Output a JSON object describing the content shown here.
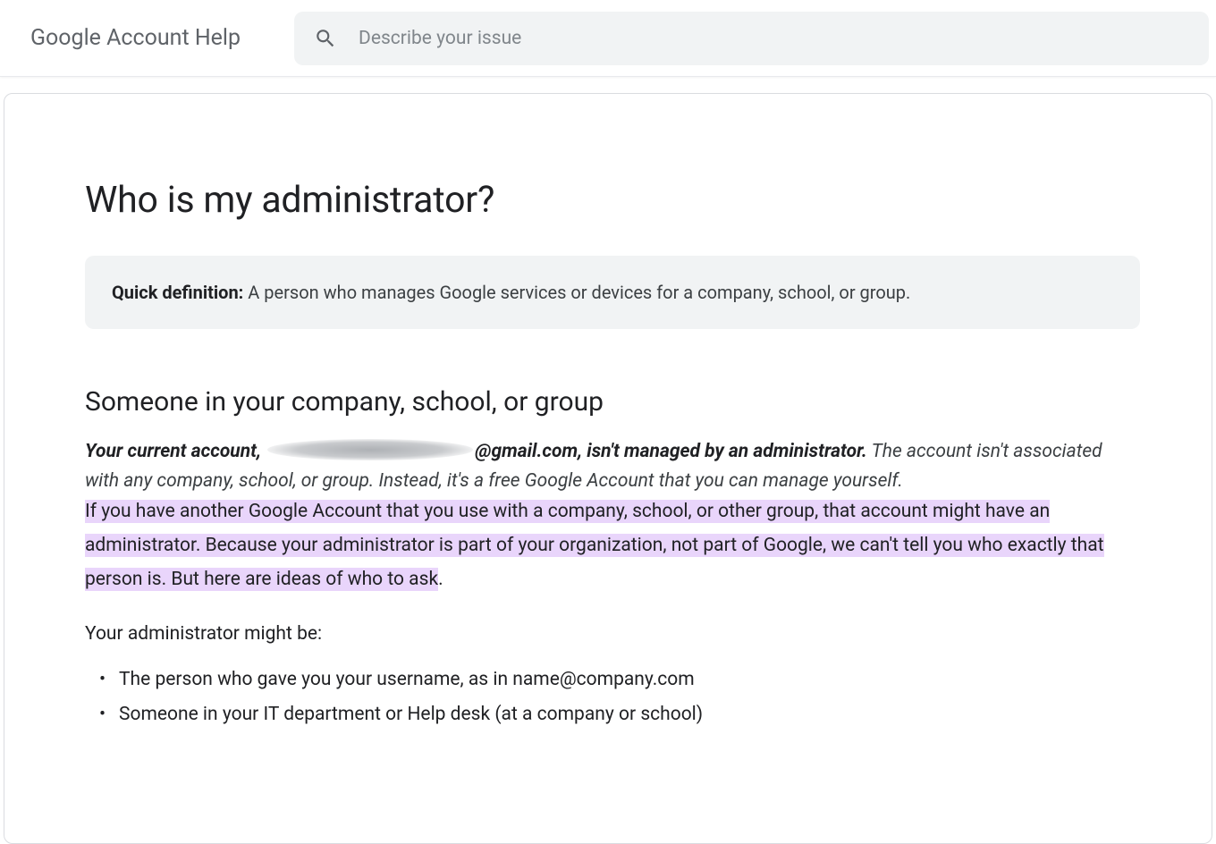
{
  "header": {
    "title": "Google Account Help",
    "search_placeholder": "Describe your issue"
  },
  "article": {
    "title": "Who is my administrator?",
    "quick_definition": {
      "label": "Quick definition:",
      "text": " A person who manages Google services or devices for a company, school, or group."
    },
    "section_heading": "Someone in your company, school, or group",
    "account_status": {
      "prefix": "Your current account, ",
      "suffix_email": "@gmail.com, isn't managed by an administrator.",
      "explanation": " The account isn't associated with any company, school, or group. Instead, it's a free Google Account that you can manage yourself."
    },
    "highlighted_text": "If you have another Google Account that you use with a company, school, or other group, that account might have an administrator. Because your administrator is part of your organization, not part of Google, we can't tell you who exactly that person is. But here are ideas of who to ask",
    "highlighted_text_period": ".",
    "list_intro": "Your administrator might be:",
    "bullets": [
      "The person who gave you your username, as in name@company.com",
      "Someone in your IT department or Help desk (at a company or school)"
    ]
  }
}
